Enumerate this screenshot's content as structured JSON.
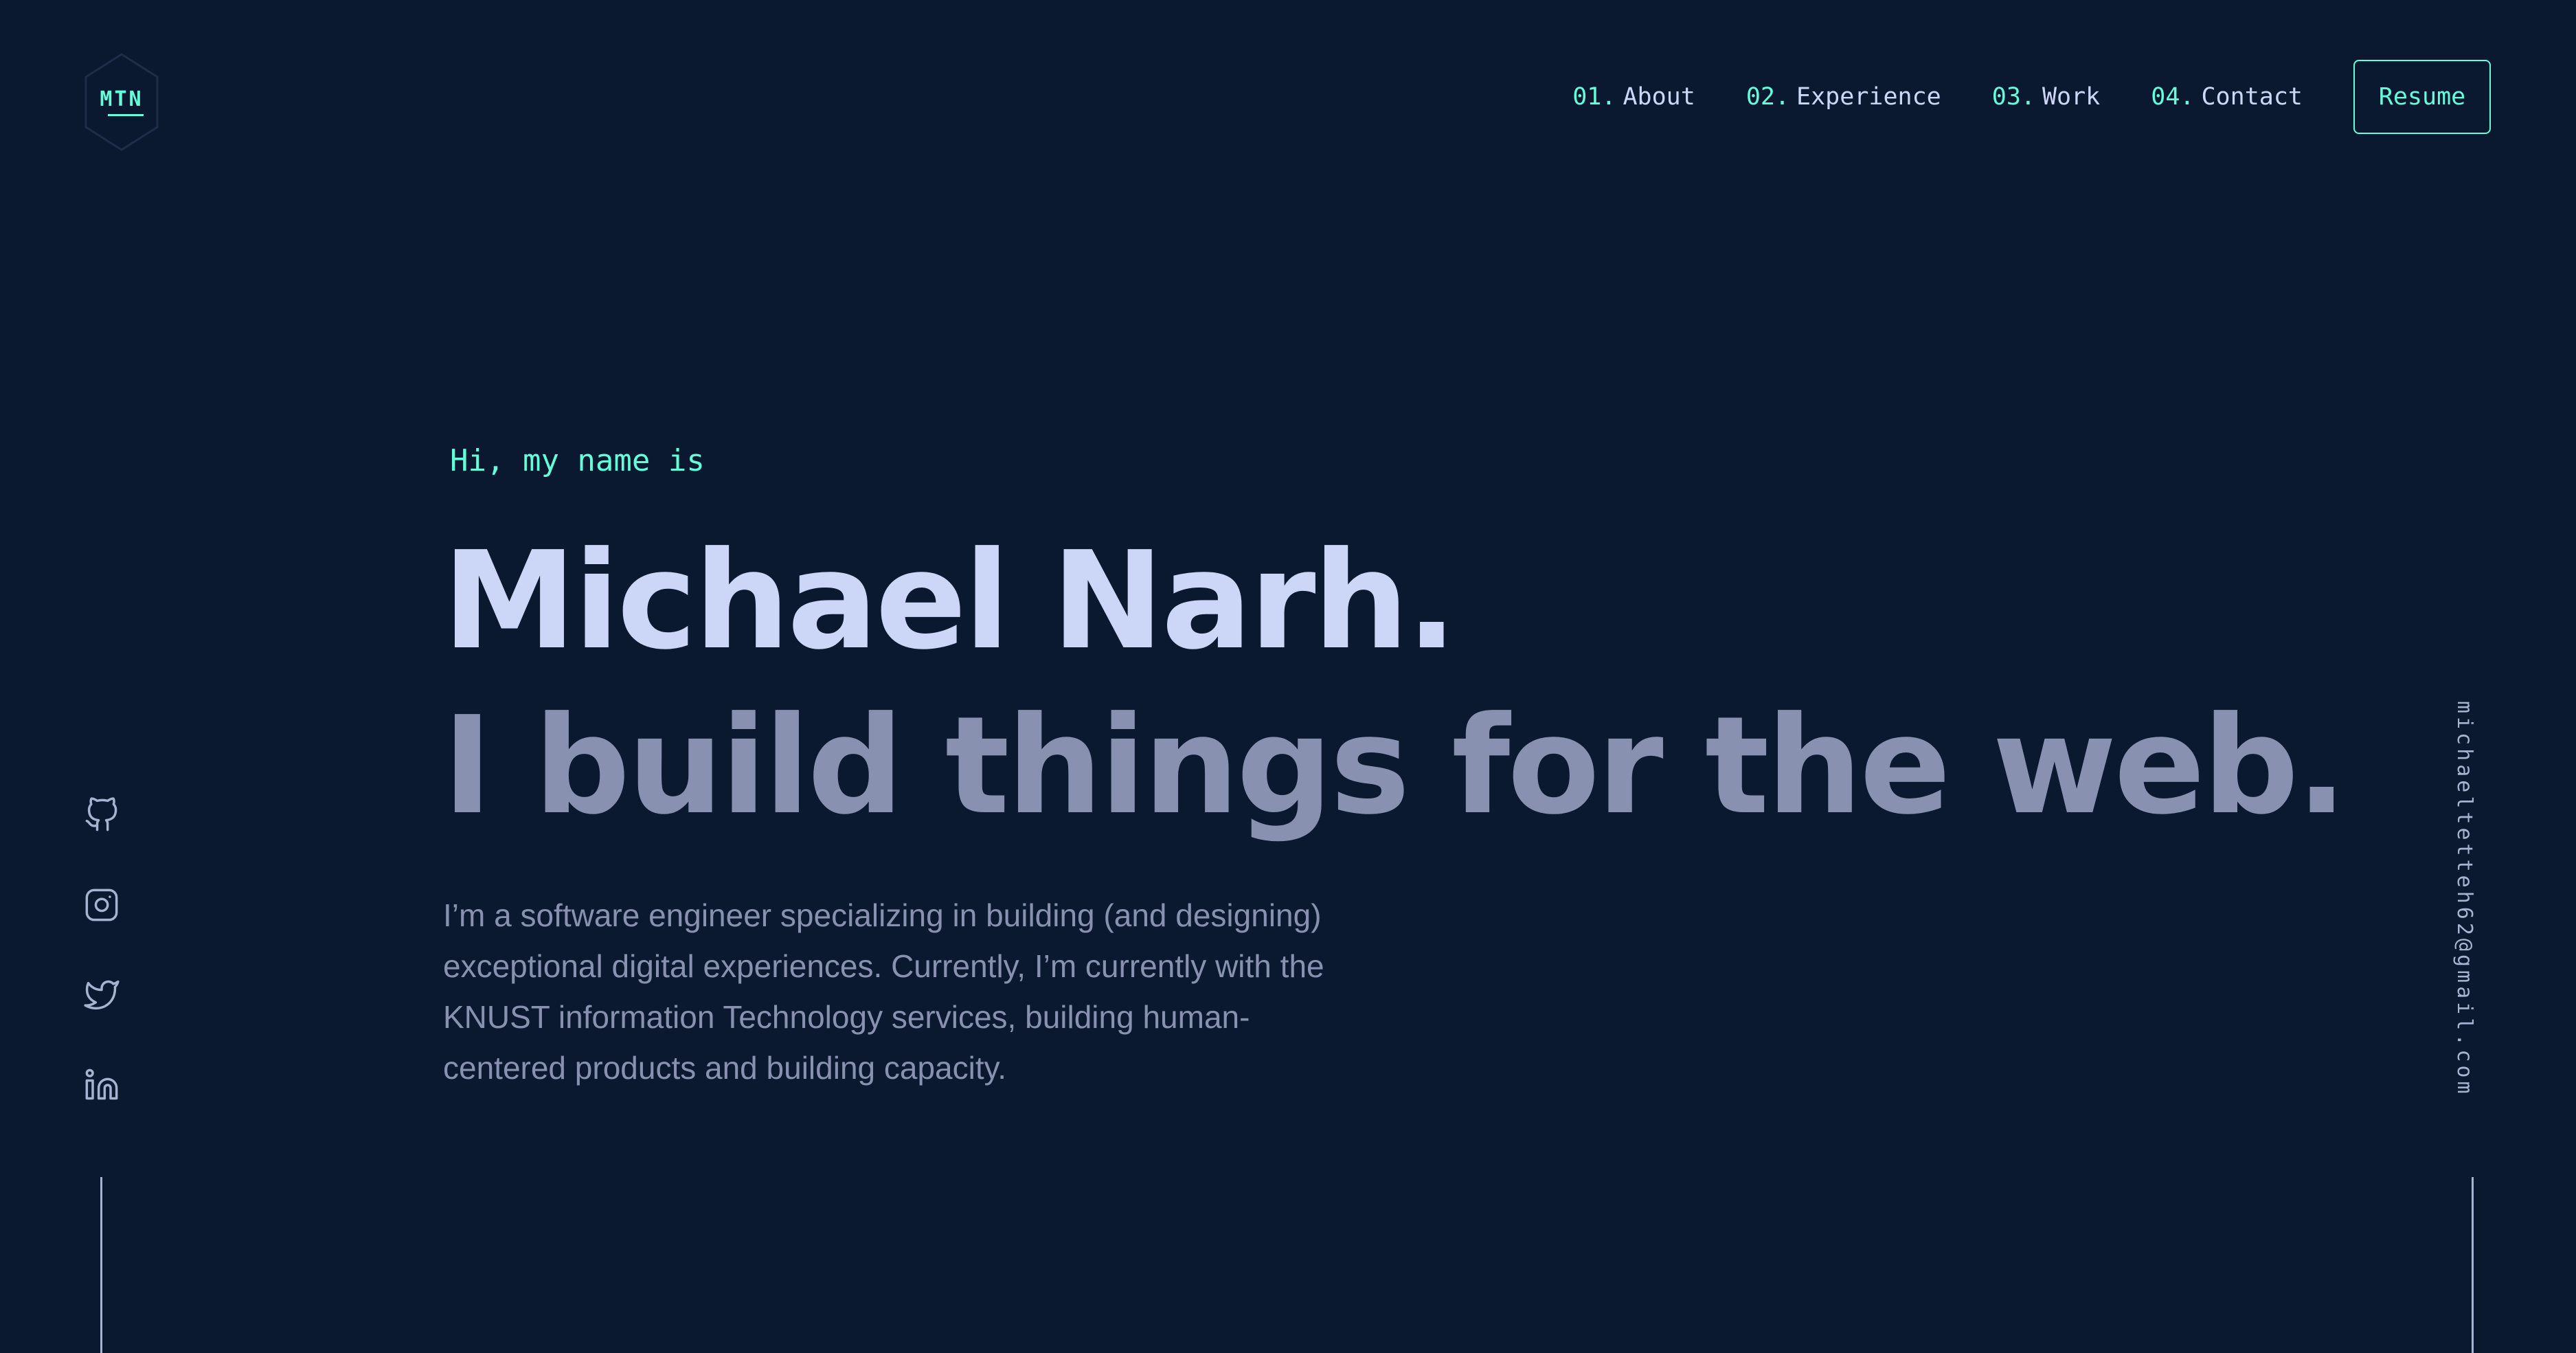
{
  "logo": {
    "text": "MTN"
  },
  "nav": {
    "items": [
      {
        "num": "01.",
        "label": "About"
      },
      {
        "num": "02.",
        "label": "Experience"
      },
      {
        "num": "03.",
        "label": "Work"
      },
      {
        "num": "04.",
        "label": "Contact"
      }
    ],
    "resume_label": "Resume"
  },
  "hero": {
    "greeting": "Hi, my name is",
    "name": "Michael Narh.",
    "tagline": "I build things for the web.",
    "intro": "I’m a software engineer specializing in building (and designing) exceptional digital experiences. Currently, I’m currently with the KNUST information Technology services, building human-centered products and building capacity."
  },
  "socials": [
    {
      "icon": "github-icon"
    },
    {
      "icon": "instagram-icon"
    },
    {
      "icon": "twitter-icon"
    },
    {
      "icon": "linkedin-icon"
    }
  ],
  "email": "michaeltetteh62@gmail.com",
  "colors": {
    "background": "#0b1930",
    "accent": "#64ffda",
    "heading": "#ccd6f6",
    "muted": "#8892b0",
    "icon": "#a8b2d1"
  }
}
